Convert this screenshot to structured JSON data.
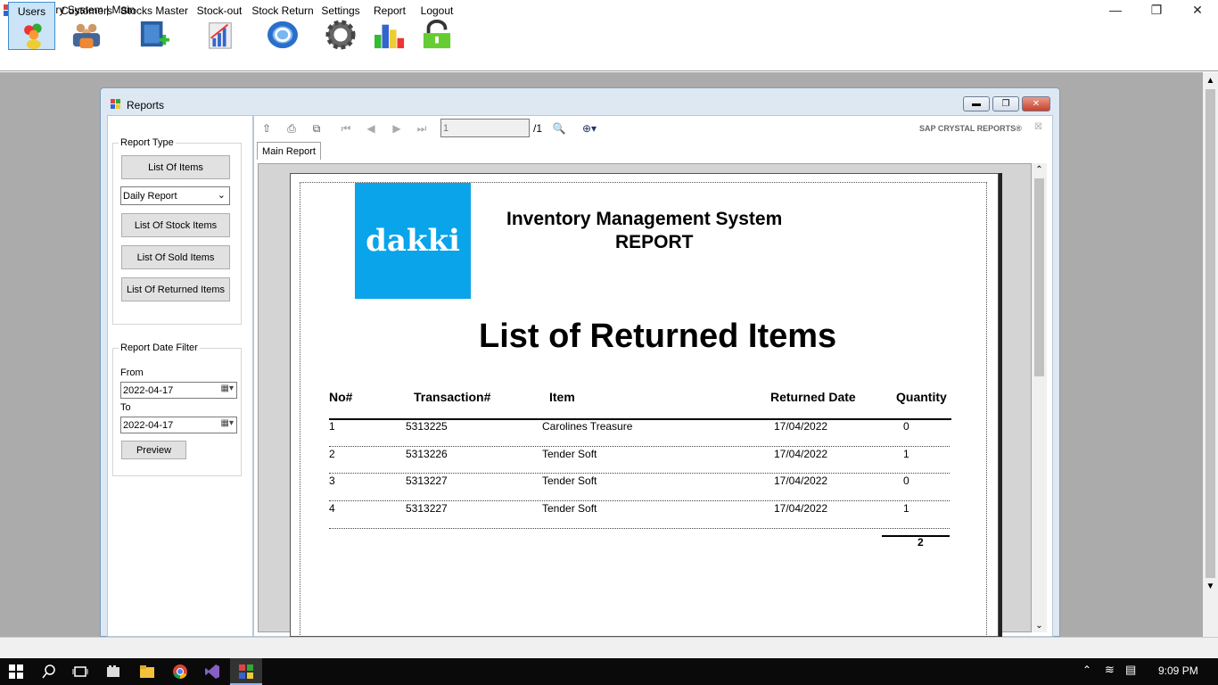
{
  "window": {
    "title": "Inventory System | Main"
  },
  "menu": [
    {
      "label": "Users",
      "icon": "users-icon"
    },
    {
      "label": "Customers",
      "icon": "customers-icon"
    },
    {
      "label": "Stocks Master",
      "icon": "stocks-master-icon"
    },
    {
      "label": "Stock-out",
      "icon": "stock-out-icon"
    },
    {
      "label": "Stock Return",
      "icon": "stock-return-icon"
    },
    {
      "label": "Settings",
      "icon": "gear-icon"
    },
    {
      "label": "Report",
      "icon": "report-icon"
    },
    {
      "label": "Logout",
      "icon": "logout-icon"
    }
  ],
  "child": {
    "title": "Reports"
  },
  "left": {
    "report_type_label": "Report Type",
    "list_of_items": "List Of Items",
    "report_select": "Daily Report",
    "list_stock": "List Of Stock Items",
    "list_sold": "List Of Sold Items",
    "list_returned": "List Of Returned Items",
    "date_filter_label": "Report Date Filter",
    "from_label": "From",
    "from_value": "2022-04-17",
    "to_label": "To",
    "to_value": "2022-04-17",
    "preview": "Preview"
  },
  "viewer": {
    "page_input": "1",
    "page_total": "/1",
    "brand": "SAP CRYSTAL REPORTS®",
    "tab": "Main Report"
  },
  "report": {
    "logo_text": "dakki",
    "header1": "Inventory Management System",
    "header2": "REPORT",
    "title": "List of Returned Items",
    "columns": [
      "No#",
      "Transaction#",
      "Item",
      "Returned Date",
      "Quantity"
    ],
    "rows": [
      [
        "1",
        "5313225",
        "Carolines Treasure",
        "17/04/2022",
        "0"
      ],
      [
        "2",
        "5313226",
        "Tender Soft",
        "17/04/2022",
        "1"
      ],
      [
        "3",
        "5313227",
        "Tender Soft",
        "17/04/2022",
        "0"
      ],
      [
        "4",
        "5313227",
        "Tender Soft",
        "17/04/2022",
        "1"
      ]
    ],
    "total": "2"
  },
  "taskbar": {
    "time": "9:09 PM"
  }
}
